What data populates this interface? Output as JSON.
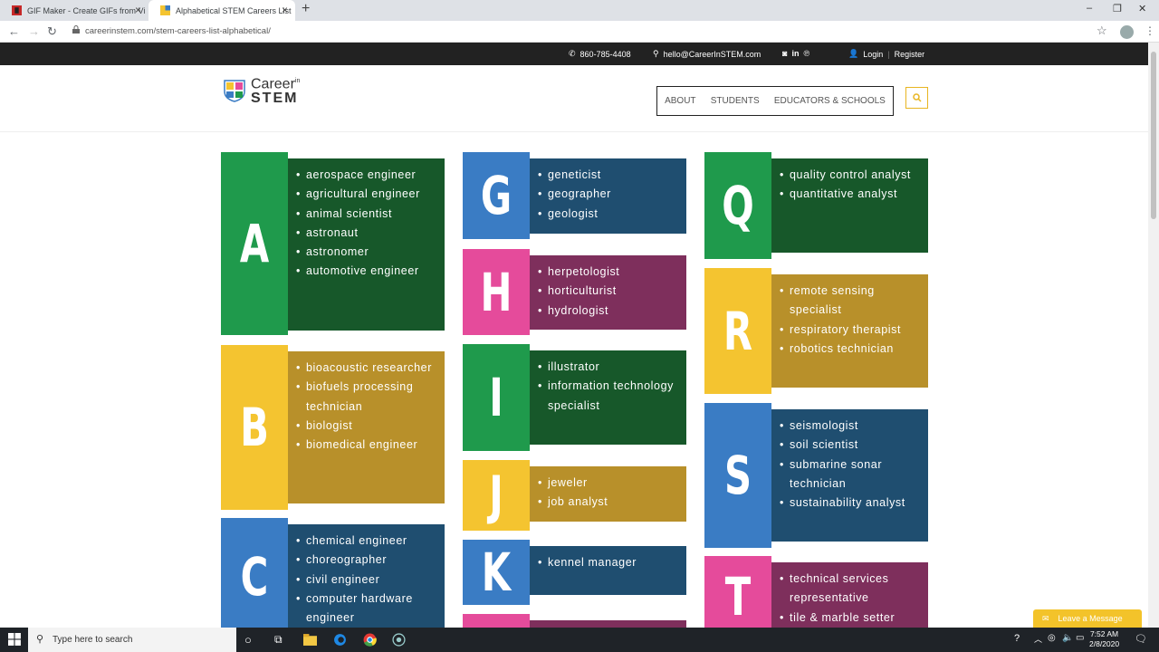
{
  "browser": {
    "tabs": [
      {
        "title": "GIF Maker - Create GIFs from Vi"
      },
      {
        "title": "Alphabetical STEM Careers List"
      }
    ],
    "url": "careerinstem.com/stem-careers-list-alphabetical/"
  },
  "topbar": {
    "phone": "860-785-4408",
    "email": "hello@CareerInSTEM.com",
    "login": "Login",
    "separator": "|",
    "register": "Register"
  },
  "header": {
    "logo_line1": "Career",
    "logo_sup": "in",
    "logo_line2": "STEM",
    "nav": [
      "ABOUT",
      "STUDENTS",
      "EDUCATORS & SCHOOLS"
    ]
  },
  "careers": {
    "A": {
      "letter": "A",
      "items": [
        "aerospace engineer",
        "agricultural engineer",
        "animal scientist",
        "astronaut",
        "astronomer",
        "automotive engineer"
      ]
    },
    "B": {
      "letter": "B",
      "items": [
        "bioacoustic researcher",
        "biofuels processing technician",
        "biologist",
        "biomedical engineer"
      ]
    },
    "C": {
      "letter": "C",
      "items": [
        "chemical engineer",
        "choreographer",
        "civil engineer",
        "computer hardware engineer"
      ]
    },
    "G": {
      "letter": "G",
      "items": [
        "geneticist",
        "geographer",
        "geologist"
      ]
    },
    "H": {
      "letter": "H",
      "items": [
        "herpetologist",
        "horticulturist",
        "hydrologist"
      ]
    },
    "I": {
      "letter": "I",
      "items": [
        "illustrator",
        "information technology specialist"
      ]
    },
    "J": {
      "letter": "J",
      "items": [
        "jeweler",
        "job analyst"
      ]
    },
    "K": {
      "letter": "K",
      "items": [
        "kennel manager"
      ]
    },
    "Q": {
      "letter": "Q",
      "items": [
        "quality control analyst",
        "quantitative analyst"
      ]
    },
    "R": {
      "letter": "R",
      "items": [
        "remote sensing specialist",
        "respiratory therapist",
        "robotics technician"
      ]
    },
    "S": {
      "letter": "S",
      "items": [
        "seismologist",
        "soil scientist",
        "submarine sonar technician",
        "sustainability analyst"
      ]
    },
    "T": {
      "letter": "T",
      "items": [
        "technical services representative",
        "tile & marble setter"
      ]
    }
  },
  "chat": {
    "label": "Leave a Message"
  },
  "taskbar": {
    "search_placeholder": "Type here to search",
    "time": "7:52 AM",
    "date": "2/8/2020"
  }
}
